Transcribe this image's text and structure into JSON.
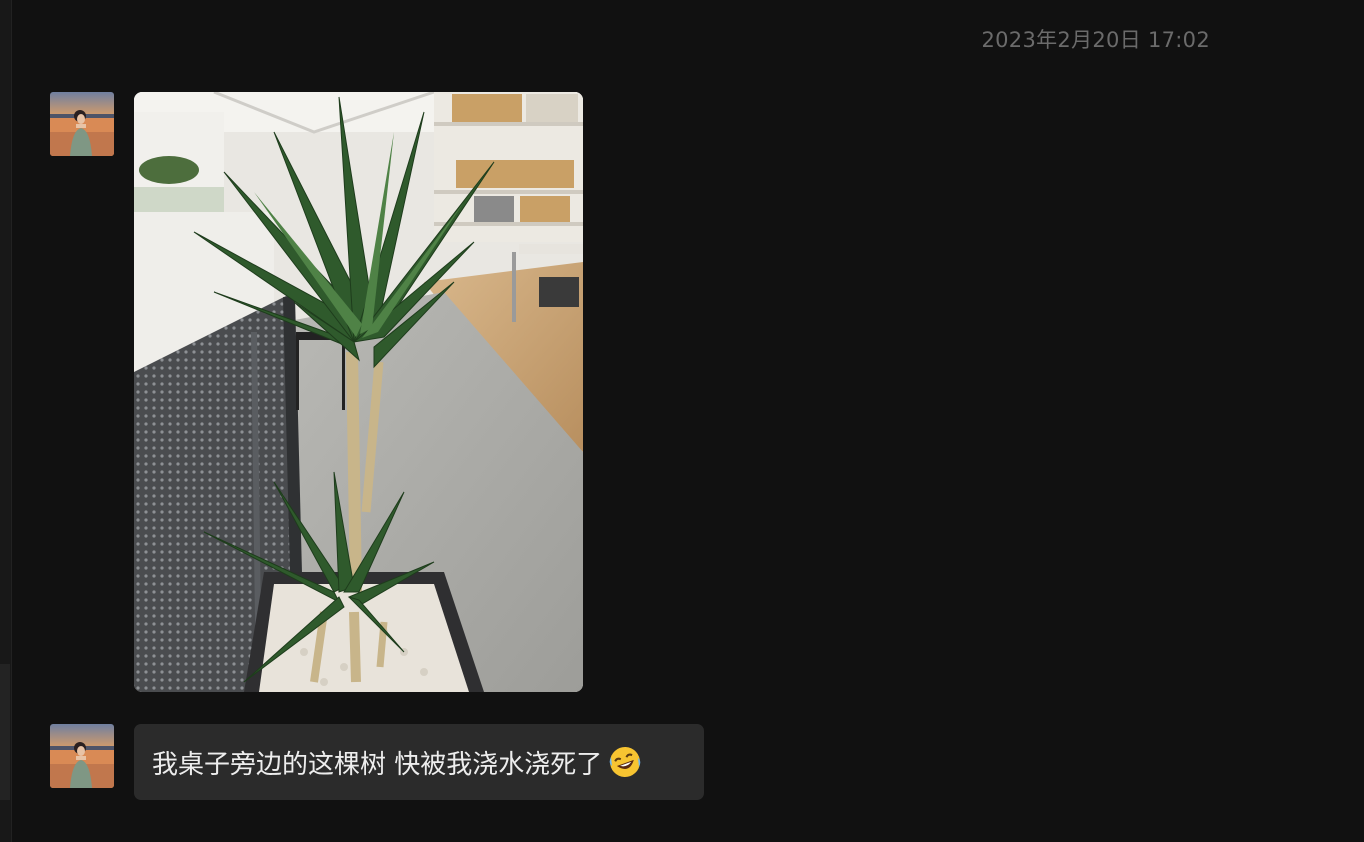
{
  "chat": {
    "timestamp": "2023年2月20日 17:02",
    "messages": [
      {
        "type": "image",
        "sender": "contact",
        "avatar_icon": "woman-lakeside-avatar",
        "image_icon": "office-plant-photo"
      },
      {
        "type": "text",
        "sender": "contact",
        "avatar_icon": "woman-lakeside-avatar",
        "text": "我桌子旁边的这棵树 快被我浇水浇死了",
        "emoji": "rolling-on-floor-laughing-emoji"
      }
    ]
  },
  "colors": {
    "background": "#111111",
    "bubble": "#2b2b2b",
    "timestamp_text": "#6b6b6b",
    "message_text": "#ededed"
  }
}
